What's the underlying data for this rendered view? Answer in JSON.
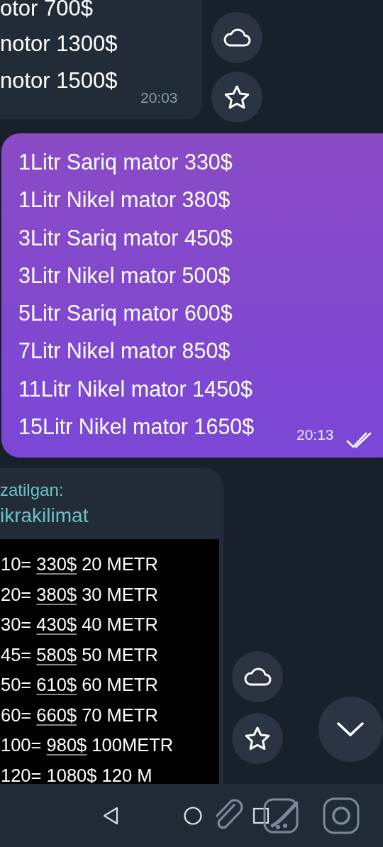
{
  "messages": [
    {
      "kind": "incoming",
      "lines": [
        "otor 700$",
        "notor 1300$",
        "notor 1500$"
      ],
      "time": "20:03"
    },
    {
      "kind": "outgoing",
      "lines": [
        "1Litr Sariq mator 330$",
        "1Litr Nikel mator 380$",
        "3Litr Sariq mator 450$",
        "3Litr Nikel mator 500$",
        "5Litr Sariq mator 600$",
        "7Litr Nikel mator 850$",
        "11Litr Nikel mator 1450$",
        "15Litr Nikel mator 1650$"
      ],
      "time": "20:13",
      "read": true
    },
    {
      "kind": "forwarded",
      "forwarded_label": "zatilgan:",
      "forwarded_from": "ikrakilimat",
      "rows": [
        {
          "qty": "10=",
          "price": "330$",
          "rest": "20 METR"
        },
        {
          "qty": "20=",
          "price": "380$",
          "rest": "30 METR"
        },
        {
          "qty": "30=",
          "price": "430$",
          "rest": "40 METR"
        },
        {
          "qty": "45=",
          "price": "580$",
          "rest": "50 METR"
        },
        {
          "qty": "50=",
          "price": "610$",
          "rest": "60 METR"
        },
        {
          "qty": "60=",
          "price": "660$",
          "rest": "70 METR"
        },
        {
          "qty": "100=",
          "price": "980$",
          "rest": "100METR"
        },
        {
          "qty": "120=",
          "price": "1080$",
          "rest": "120 M"
        }
      ]
    }
  ]
}
